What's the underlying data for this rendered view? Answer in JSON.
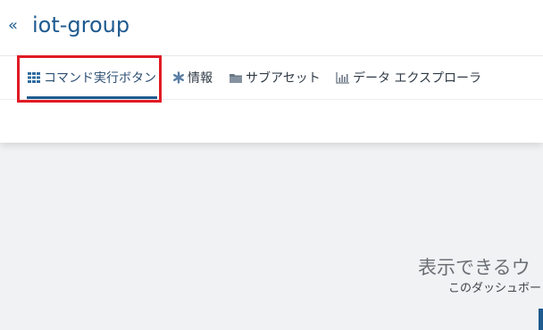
{
  "header": {
    "back_glyph": "«",
    "title": "iot-group"
  },
  "tabs": [
    {
      "label": "コマンド実行ボタン",
      "icon": "grid-icon",
      "active": true
    },
    {
      "label": "情報",
      "icon": "asterisk-icon",
      "active": false
    },
    {
      "label": "サブアセット",
      "icon": "folder-icon",
      "active": false
    },
    {
      "label": "データ エクスプローラ",
      "icon": "bar-chart-icon",
      "active": false
    }
  ],
  "empty_state": {
    "title": "表示できるウ",
    "subtitle": "このダッシュボー"
  },
  "colors": {
    "accent": "#1f5a8f",
    "highlight": "#e01b24",
    "background": "#f1f2f4"
  }
}
